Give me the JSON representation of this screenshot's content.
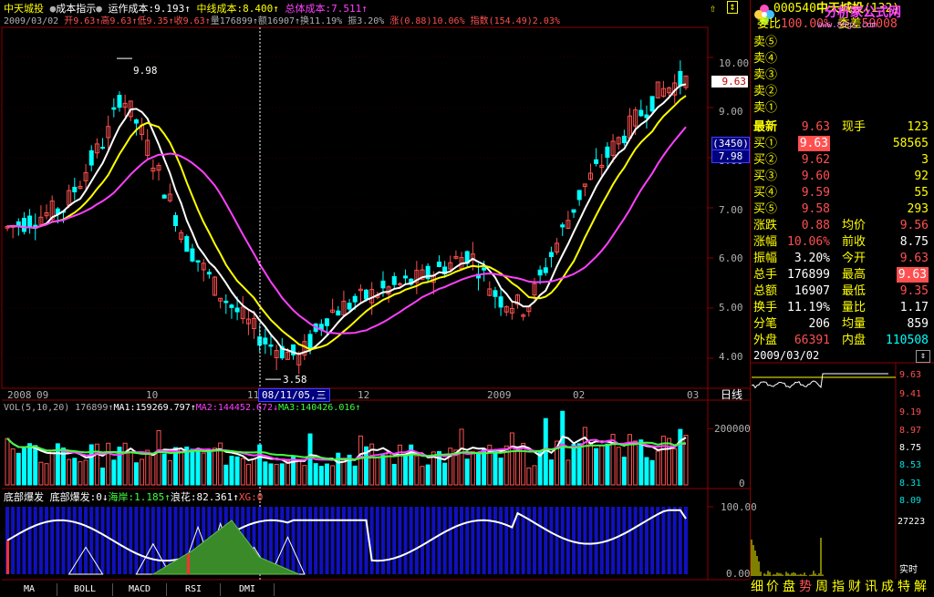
{
  "colors": {
    "rise": "#ff5050",
    "fall": "#00ffff",
    "ma5": "#ffffff",
    "ma10": "#ffff00",
    "ma20": "#ff40ff",
    "grid": "#8b0000"
  },
  "header": {
    "stock_name": "中天城投",
    "ind1": "成本指示",
    "run_cost_label": "运作成本:",
    "run_cost": "9.193",
    "mid_cost_label": "中线成本:",
    "mid_cost": "8.400",
    "total_cost_label": "总体成本:",
    "total_cost": "7.511",
    "date": "2009/03/02",
    "open_label": "开",
    "open": "9.63",
    "high_label": "高",
    "high": "9.63",
    "low_label": "低",
    "low": "9.35",
    "close_label": "收",
    "close": "9.63",
    "vol_label": "量",
    "vol": "176899",
    "amt_label": "额",
    "amt": "16907",
    "turn_label": "换",
    "turn": "11.19%",
    "amp_label": "振",
    "amp": "3.20%",
    "chg_label": "涨",
    "chg": "(0.88)10.06%",
    "idx_label": "指数",
    "idx": "(154.49)2.03%"
  },
  "price_axis": [
    "10.00",
    "9.00",
    "8.00",
    "7.00",
    "6.00",
    "5.00",
    "4.00"
  ],
  "price_tag": "9.63",
  "cursor_tag_top": "(3450)",
  "cursor_tag_bottom": "7.98",
  "annotations": {
    "high": "9.98",
    "low": "3.58"
  },
  "date_axis": [
    "2008",
    "09",
    "10",
    "11",
    "12",
    "2009",
    "02",
    "03"
  ],
  "date_cursor": "08/11/05,三",
  "date_unit": "日线",
  "vol_header": {
    "label": "VOL(5,10,20)",
    "value": "176899",
    "ma1": "MA1:159269.797",
    "ma2": "MA2:144452.672",
    "ma3": "MA3:140426.016"
  },
  "vol_axis": [
    "200000",
    "0"
  ],
  "ind_header": {
    "name": "底部爆发",
    "sub": "底部爆发:0",
    "haian": "海岸:1.185",
    "langhua": "浪花:82.361",
    "xg": "XG:0"
  },
  "ind_axis": [
    "100.00",
    "0.00"
  ],
  "tabs": [
    "MA",
    "BOLL",
    "MACD",
    "RSI",
    "DMI"
  ],
  "quote": {
    "code": "000540",
    "name": "中天城投",
    "suffix": "(132)",
    "ratio_label": "委比",
    "ratio": "100.00%",
    "diff_label": "委差",
    "diff": "59008",
    "site": "www.88gs.com",
    "site_logo": "分析家公式网",
    "sells": [
      "卖⑤",
      "卖④",
      "卖③",
      "卖②",
      "卖①"
    ],
    "last_label": "最新",
    "last": "9.63",
    "cur_hand_label": "现手",
    "cur_hand": "123",
    "buys": [
      {
        "label": "买①",
        "price": "9.63",
        "vol": "58565"
      },
      {
        "label": "买②",
        "price": "9.62",
        "vol": "3"
      },
      {
        "label": "买③",
        "price": "9.60",
        "vol": "92"
      },
      {
        "label": "买④",
        "price": "9.59",
        "vol": "55"
      },
      {
        "label": "买⑤",
        "price": "9.58",
        "vol": "293"
      }
    ],
    "stats": [
      {
        "l1": "涨跌",
        "v1": "0.88",
        "l2": "均价",
        "v2": "9.56"
      },
      {
        "l1": "涨幅",
        "v1": "10.06%",
        "l2": "前收",
        "v2": "8.75"
      },
      {
        "l1": "振幅",
        "v1": "3.20%",
        "l2": "今开",
        "v2": "9.63"
      },
      {
        "l1": "总手",
        "v1": "176899",
        "l2": "最高",
        "v2": "9.63"
      },
      {
        "l1": "总额",
        "v1": "16907",
        "l2": "最低",
        "v2": "9.35"
      },
      {
        "l1": "换手",
        "v1": "11.19%",
        "l2": "量比",
        "v2": "1.17"
      },
      {
        "l1": "分笔",
        "v1": "206",
        "l2": "均量",
        "v2": "859"
      }
    ],
    "outer_label": "外盘",
    "outer": "66391",
    "inner_label": "内盘",
    "inner": "110508",
    "mini_date": "2009/03/02",
    "mini_axis": [
      "9.63",
      "9.41",
      "9.19",
      "8.97",
      "8.75",
      "8.53",
      "8.31",
      "8.09"
    ],
    "mini_vol": "27223",
    "realtime": "实时"
  },
  "bottom_bar": [
    "细",
    "价",
    "盘",
    "势",
    "周",
    "指",
    "财",
    "讯",
    "成",
    "特",
    "解"
  ],
  "chart_data": {
    "type": "candlestick",
    "ylim": [
      3.4,
      10.6
    ],
    "candles_note": "approx daily OHLC Sept 2008 - Mar 2 2009",
    "ma_series": [
      {
        "name": "运作成本",
        "value": 9.193
      },
      {
        "name": "中线成本",
        "value": 8.4
      },
      {
        "name": "总体成本",
        "value": 7.511
      }
    ],
    "volume": {
      "ma1": 159269.797,
      "ma2": 144452.672,
      "ma3": 140426.016,
      "last": 176899,
      "ylim": [
        0,
        260000
      ]
    },
    "indicator": {
      "haian": 1.185,
      "langhua": 82.361,
      "ylim": [
        0,
        100
      ]
    }
  }
}
